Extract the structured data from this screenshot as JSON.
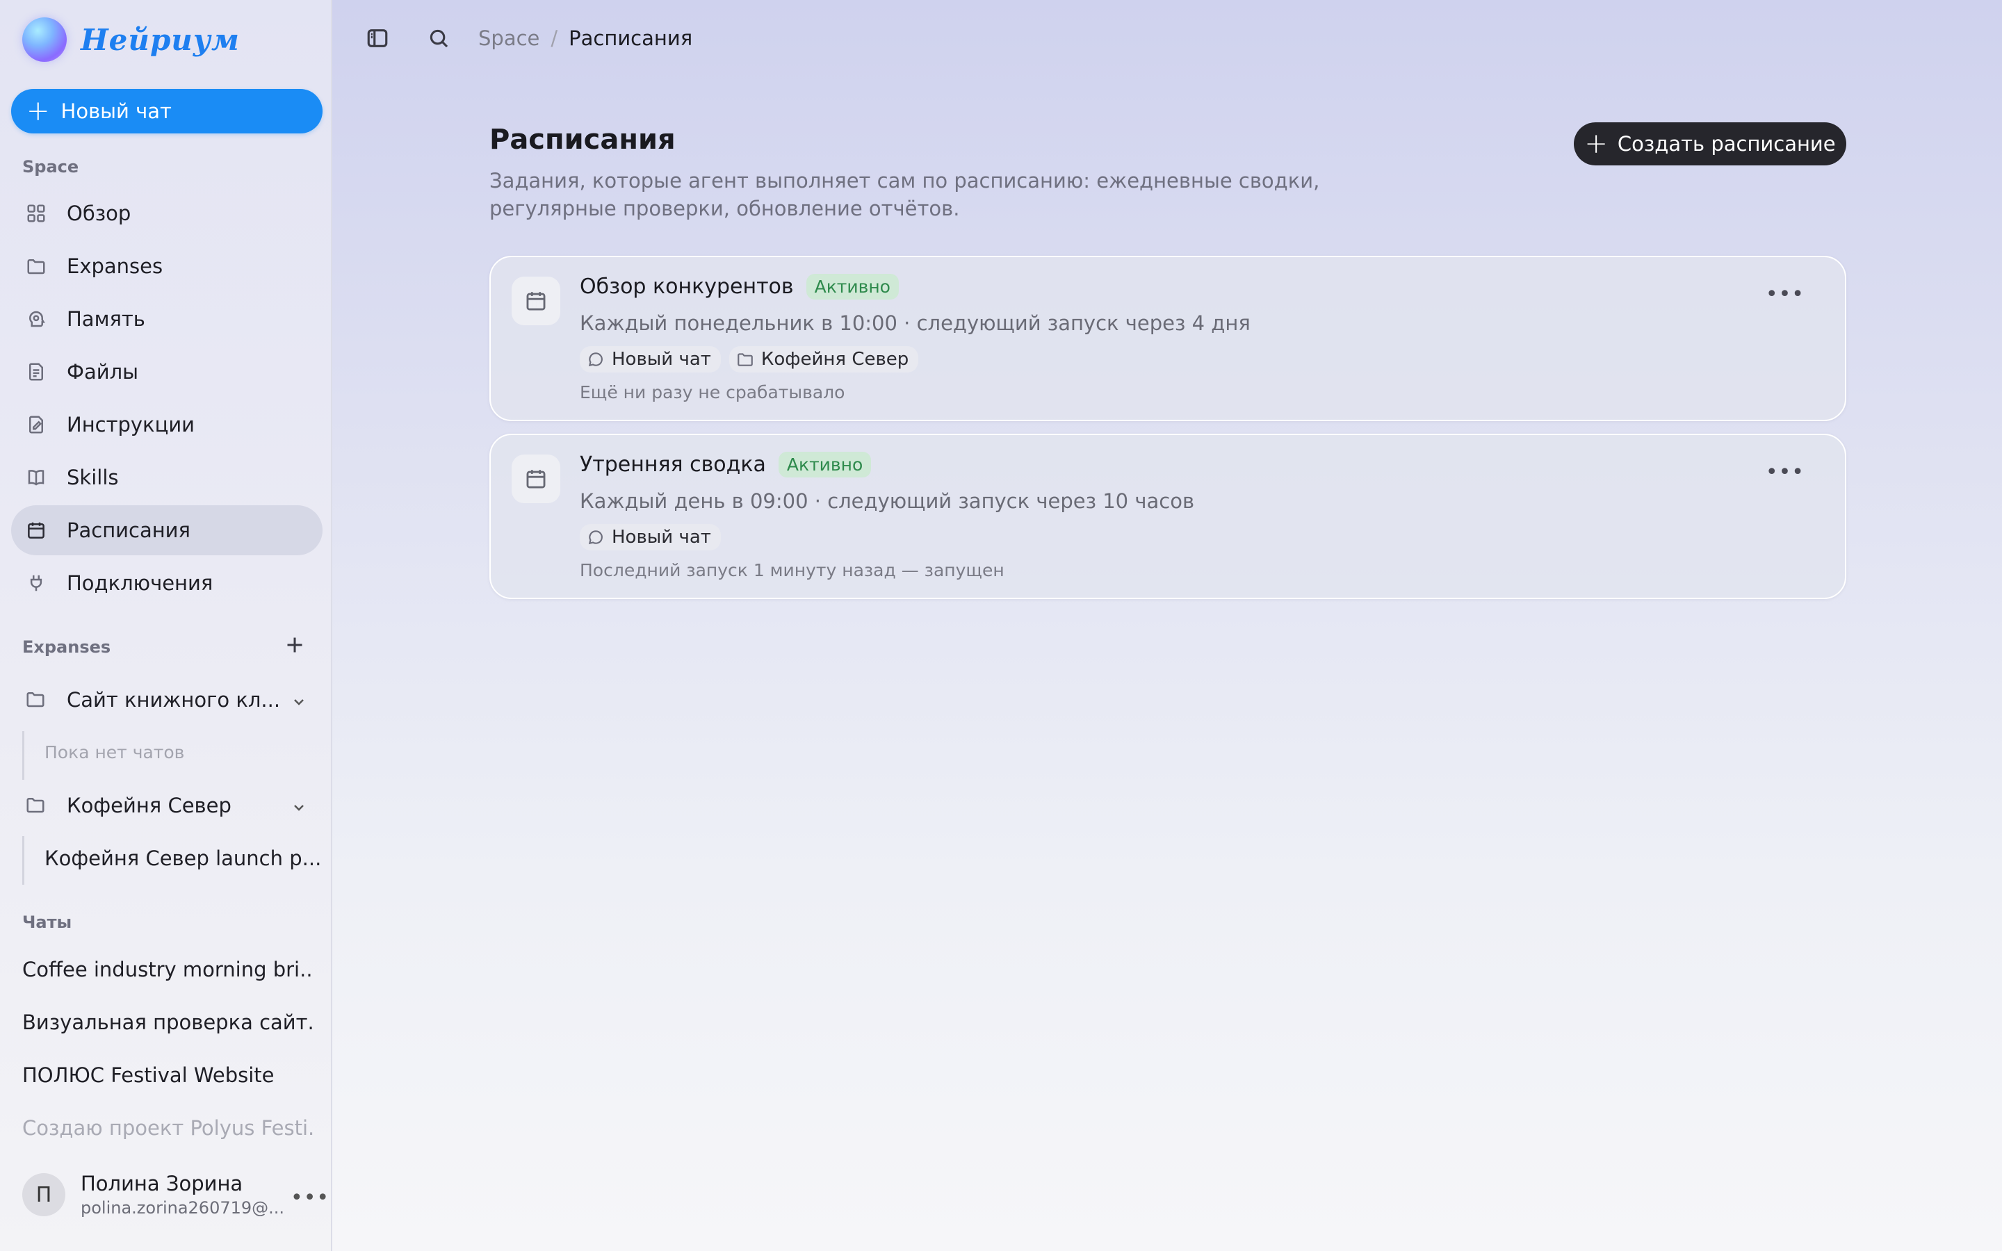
{
  "brand": {
    "name": "Нейриум"
  },
  "sidebar": {
    "new_chat_label": "Новый чат",
    "space_label": "Space",
    "nav": [
      {
        "label": "Обзор",
        "icon": "grid-icon"
      },
      {
        "label": "Expanses",
        "icon": "folder-icon"
      },
      {
        "label": "Память",
        "icon": "brain-icon"
      },
      {
        "label": "Файлы",
        "icon": "file-icon"
      },
      {
        "label": "Инструкции",
        "icon": "instructions-icon"
      },
      {
        "label": "Skills",
        "icon": "book-icon"
      },
      {
        "label": "Расписания",
        "icon": "calendar-icon",
        "active": true
      },
      {
        "label": "Подключения",
        "icon": "plug-icon"
      }
    ],
    "expanses_label": "Expanses",
    "expanses": [
      {
        "label": "Сайт книжного кл...",
        "empty_text": "Пока нет чатов"
      },
      {
        "label": "Кофейня Север",
        "child": "Кофейня Север launch p..."
      }
    ],
    "chats_label": "Чаты",
    "chats": [
      "Coffee industry morning bri...",
      "Визуальная проверка сайт...",
      "ПОЛЮС Festival Website",
      "Создаю проект Polyus Festi..."
    ],
    "user": {
      "initial": "П",
      "name": "Полина Зорина",
      "email": "polina.zorina260719@..."
    }
  },
  "topbar": {
    "breadcrumb_root": "Space",
    "breadcrumb_sep": "/",
    "breadcrumb_current": "Расписания"
  },
  "main": {
    "title": "Расписания",
    "description": "Задания, которые агент выполняет сам по расписанию: ежедневные сводки, регулярные проверки, обновление отчётов.",
    "create_label": "Создать расписание",
    "schedules": [
      {
        "title": "Обзор конкурентов",
        "status": "Активно",
        "schedule": "Каждый понедельник в 10:00 · следующий запуск через 4 дня",
        "chips": [
          {
            "label": "Новый чат",
            "icon": "chat-icon"
          },
          {
            "label": "Кофейня Север",
            "icon": "folder-icon"
          }
        ],
        "footer": "Ещё ни разу не срабатывало"
      },
      {
        "title": "Утренняя сводка",
        "status": "Активно",
        "schedule": "Каждый день в 09:00 · следующий запуск через 10 часов",
        "chips": [
          {
            "label": "Новый чат",
            "icon": "chat-icon"
          }
        ],
        "footer": "Последний запуск 1 минуту назад — запущен"
      }
    ]
  },
  "colors": {
    "accent": "#1a8cf5",
    "dark_button": "#26262c",
    "badge_bg": "#cfe9d6",
    "badge_text": "#2e8a4c"
  }
}
